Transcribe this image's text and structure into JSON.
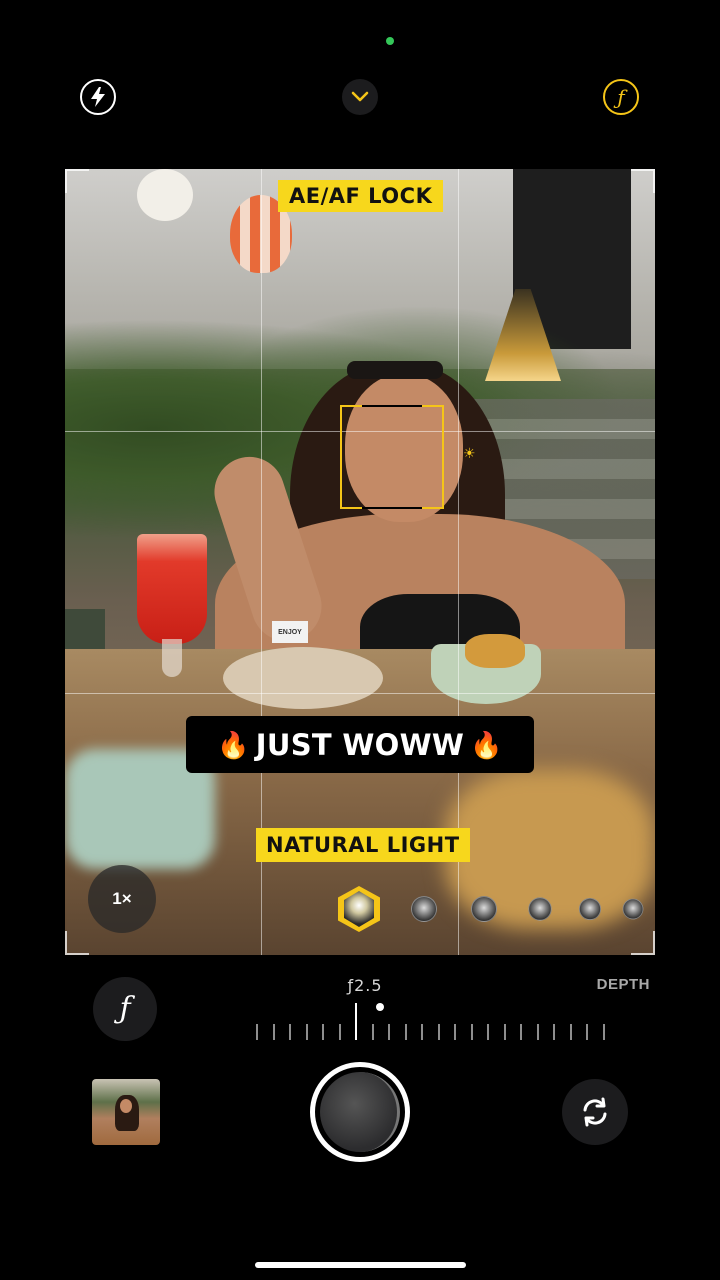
{
  "status": {
    "camera_in_use_color": "#34c759"
  },
  "top_bar": {
    "flash_icon": "lightning-bolt-icon",
    "chevron_icon": "chevron-down-icon",
    "aperture_glyph": "ƒ",
    "accent_color": "#f5c518"
  },
  "viewfinder": {
    "overlay_labels": {
      "ae_af_lock": "AE/AF LOCK",
      "lighting_mode": "NATURAL LIGHT"
    },
    "caption": {
      "emoji_left": "🔥",
      "text": "JUST WOWW",
      "emoji_right": "🔥"
    },
    "scene_card_text": "ENJOY",
    "zoom": "1×",
    "lighting_options_count": 6,
    "lighting_selected_index": 0
  },
  "depth_control": {
    "button_glyph": "ƒ",
    "value": "ƒ2.5",
    "label": "DEPTH"
  },
  "bottom_bar": {
    "thumbnail_icon": "last-photo-thumbnail",
    "shutter_icon": "shutter-button",
    "flip_icon": "camera-flip-icon"
  }
}
